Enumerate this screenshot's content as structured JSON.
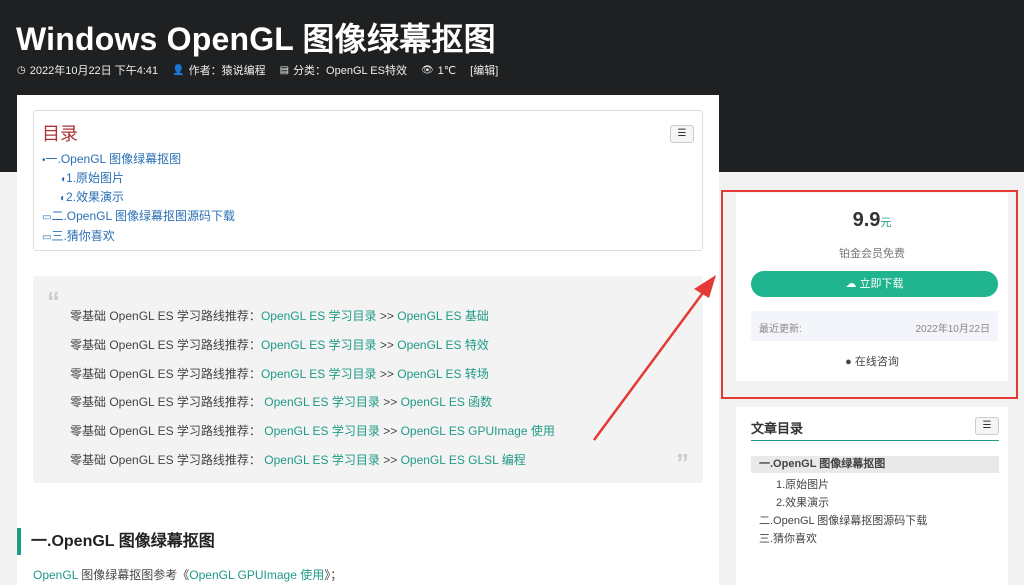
{
  "header": {
    "title": "Windows OpenGL 图像绿幕抠图",
    "date": "2022年10月22日 下午4:41",
    "author": "作者：猿说编程",
    "category": "分类：OpenGL ES特效",
    "views": "1℃",
    "edit": "[编辑]"
  },
  "toc": {
    "title": "目录",
    "toggle_icon": "☰",
    "items": [
      {
        "bullet": "•",
        "label": "一.OpenGL 图像绿幕抠图"
      },
      {
        "bullet": "◖",
        "label": "1.原始图片"
      },
      {
        "bullet": "◐",
        "label": "2.效果演示"
      },
      {
        "bullet": "▭",
        "label": "二.OpenGL 图像绿幕抠图源码下载"
      },
      {
        "bullet": "▭",
        "label": "三.猜你喜欢"
      }
    ]
  },
  "quote": {
    "open": "“",
    "close": "”",
    "lines": [
      {
        "prefix": "零基础 OpenGL ES 学习路线推荐：",
        "link1": "OpenGL ES 学习目录",
        "sep": " >> ",
        "link2": "OpenGL ES 基础"
      },
      {
        "prefix": "零基础 OpenGL ES 学习路线推荐：",
        "link1": "OpenGL ES 学习目录",
        "sep": "  >> ",
        "link2": "OpenGL ES 特效"
      },
      {
        "prefix": "零基础 OpenGL ES 学习路线推荐：",
        "link1": "OpenGL ES 学习目录",
        "sep": "  >> ",
        "link2": "OpenGL ES 转场"
      },
      {
        "prefix": "零基础 OpenGL ES 学习路线推荐： ",
        "link1": "OpenGL ES 学习目录",
        "sep": " >> ",
        "link2": "OpenGL ES 函数"
      },
      {
        "prefix": "零基础 OpenGL ES 学习路线推荐： ",
        "link1": "OpenGL ES 学习目录",
        "sep": " >> ",
        "link2": "OpenGL ES GPUImage 使用"
      },
      {
        "prefix": "零基础 OpenGL ES 学习路线推荐： ",
        "link1": "OpenGL ES 学习目录",
        "sep": " >> ",
        "link2": "OpenGL ES GLSL 编程"
      }
    ]
  },
  "section": {
    "heading": "一.OpenGL 图像绿幕抠图",
    "para_link1": "OpenGL",
    "para_text": " 图像绿幕抠图参考《",
    "para_link2": "OpenGL GPUImage 使用",
    "para_end": "》；"
  },
  "card": {
    "price": "9.9",
    "unit": "元",
    "member": "铂金会员免费",
    "download": "立即下载",
    "updated_label": "最近更新:",
    "updated_date": "2022年10月22日",
    "consult": "在线咨询"
  },
  "side_toc": {
    "title": "文章目录",
    "toggle_icon": "☰",
    "items": [
      "一.OpenGL 图像绿幕抠图",
      "1.原始图片",
      "2.效果演示",
      "二.OpenGL 图像绿幕抠图源码下载",
      "三.猜你喜欢"
    ]
  },
  "colors": {
    "accent": "#1f9a86",
    "button": "#1fb48e",
    "highlight": "#e53935",
    "header_bg": "#1e2022"
  }
}
